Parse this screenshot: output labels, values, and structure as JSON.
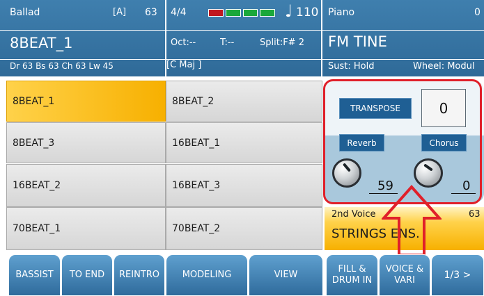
{
  "style_header": {
    "category": "Ballad",
    "variation_tag": "[A]",
    "volume": "63",
    "style_name": "8BEAT_1",
    "volumes_line": "Dr 63  Bs 63  Ch 63  Lw 45"
  },
  "center_header": {
    "time_signature": "4/4",
    "tempo_glyph": "♩",
    "tempo": "110",
    "octave": "Oct:--",
    "transpose": "T:--",
    "split": "Split:F# 2",
    "chord": "[C Maj          ]",
    "beat_indicator_colors": [
      "#c0181f",
      "#1aa83a",
      "#1aa83a",
      "#1aa83a"
    ]
  },
  "voice_header": {
    "category": "Piano",
    "number": "0",
    "voice_name": "FM TINE",
    "sustain": "Sust: Hold",
    "wheel": "Wheel: Modul"
  },
  "styles": [
    {
      "label": "8BEAT_1",
      "selected": true
    },
    {
      "label": "8BEAT_2",
      "selected": false
    },
    {
      "label": "8BEAT_3",
      "selected": false
    },
    {
      "label": "16BEAT_1",
      "selected": false
    },
    {
      "label": "16BEAT_2",
      "selected": false
    },
    {
      "label": "16BEAT_3",
      "selected": false
    },
    {
      "label": "70BEAT_1",
      "selected": false
    },
    {
      "label": "70BEAT_2",
      "selected": false
    }
  ],
  "panel": {
    "transpose_label": "TRANSPOSE",
    "transpose_value": "0",
    "reverb_label": "Reverb",
    "chorus_label": "Chorus",
    "reverb_value": "59",
    "chorus_value": "0"
  },
  "second_voice": {
    "label": "2nd Voice",
    "volume": "63",
    "name": "STRINGS ENS."
  },
  "bottom_buttons": [
    {
      "label": "BASSIST"
    },
    {
      "label": "TO END"
    },
    {
      "label": "REINTRO"
    },
    {
      "label": "MODELING"
    },
    {
      "label": "VIEW"
    },
    {
      "label": "FILL & DRUM IN"
    },
    {
      "label": "VOICE & VARI"
    },
    {
      "label": "1/3 >"
    }
  ],
  "colors": {
    "header_blue": "#3a78a8",
    "selected_yellow": "#f7b000",
    "highlight_red": "#e0202a"
  }
}
